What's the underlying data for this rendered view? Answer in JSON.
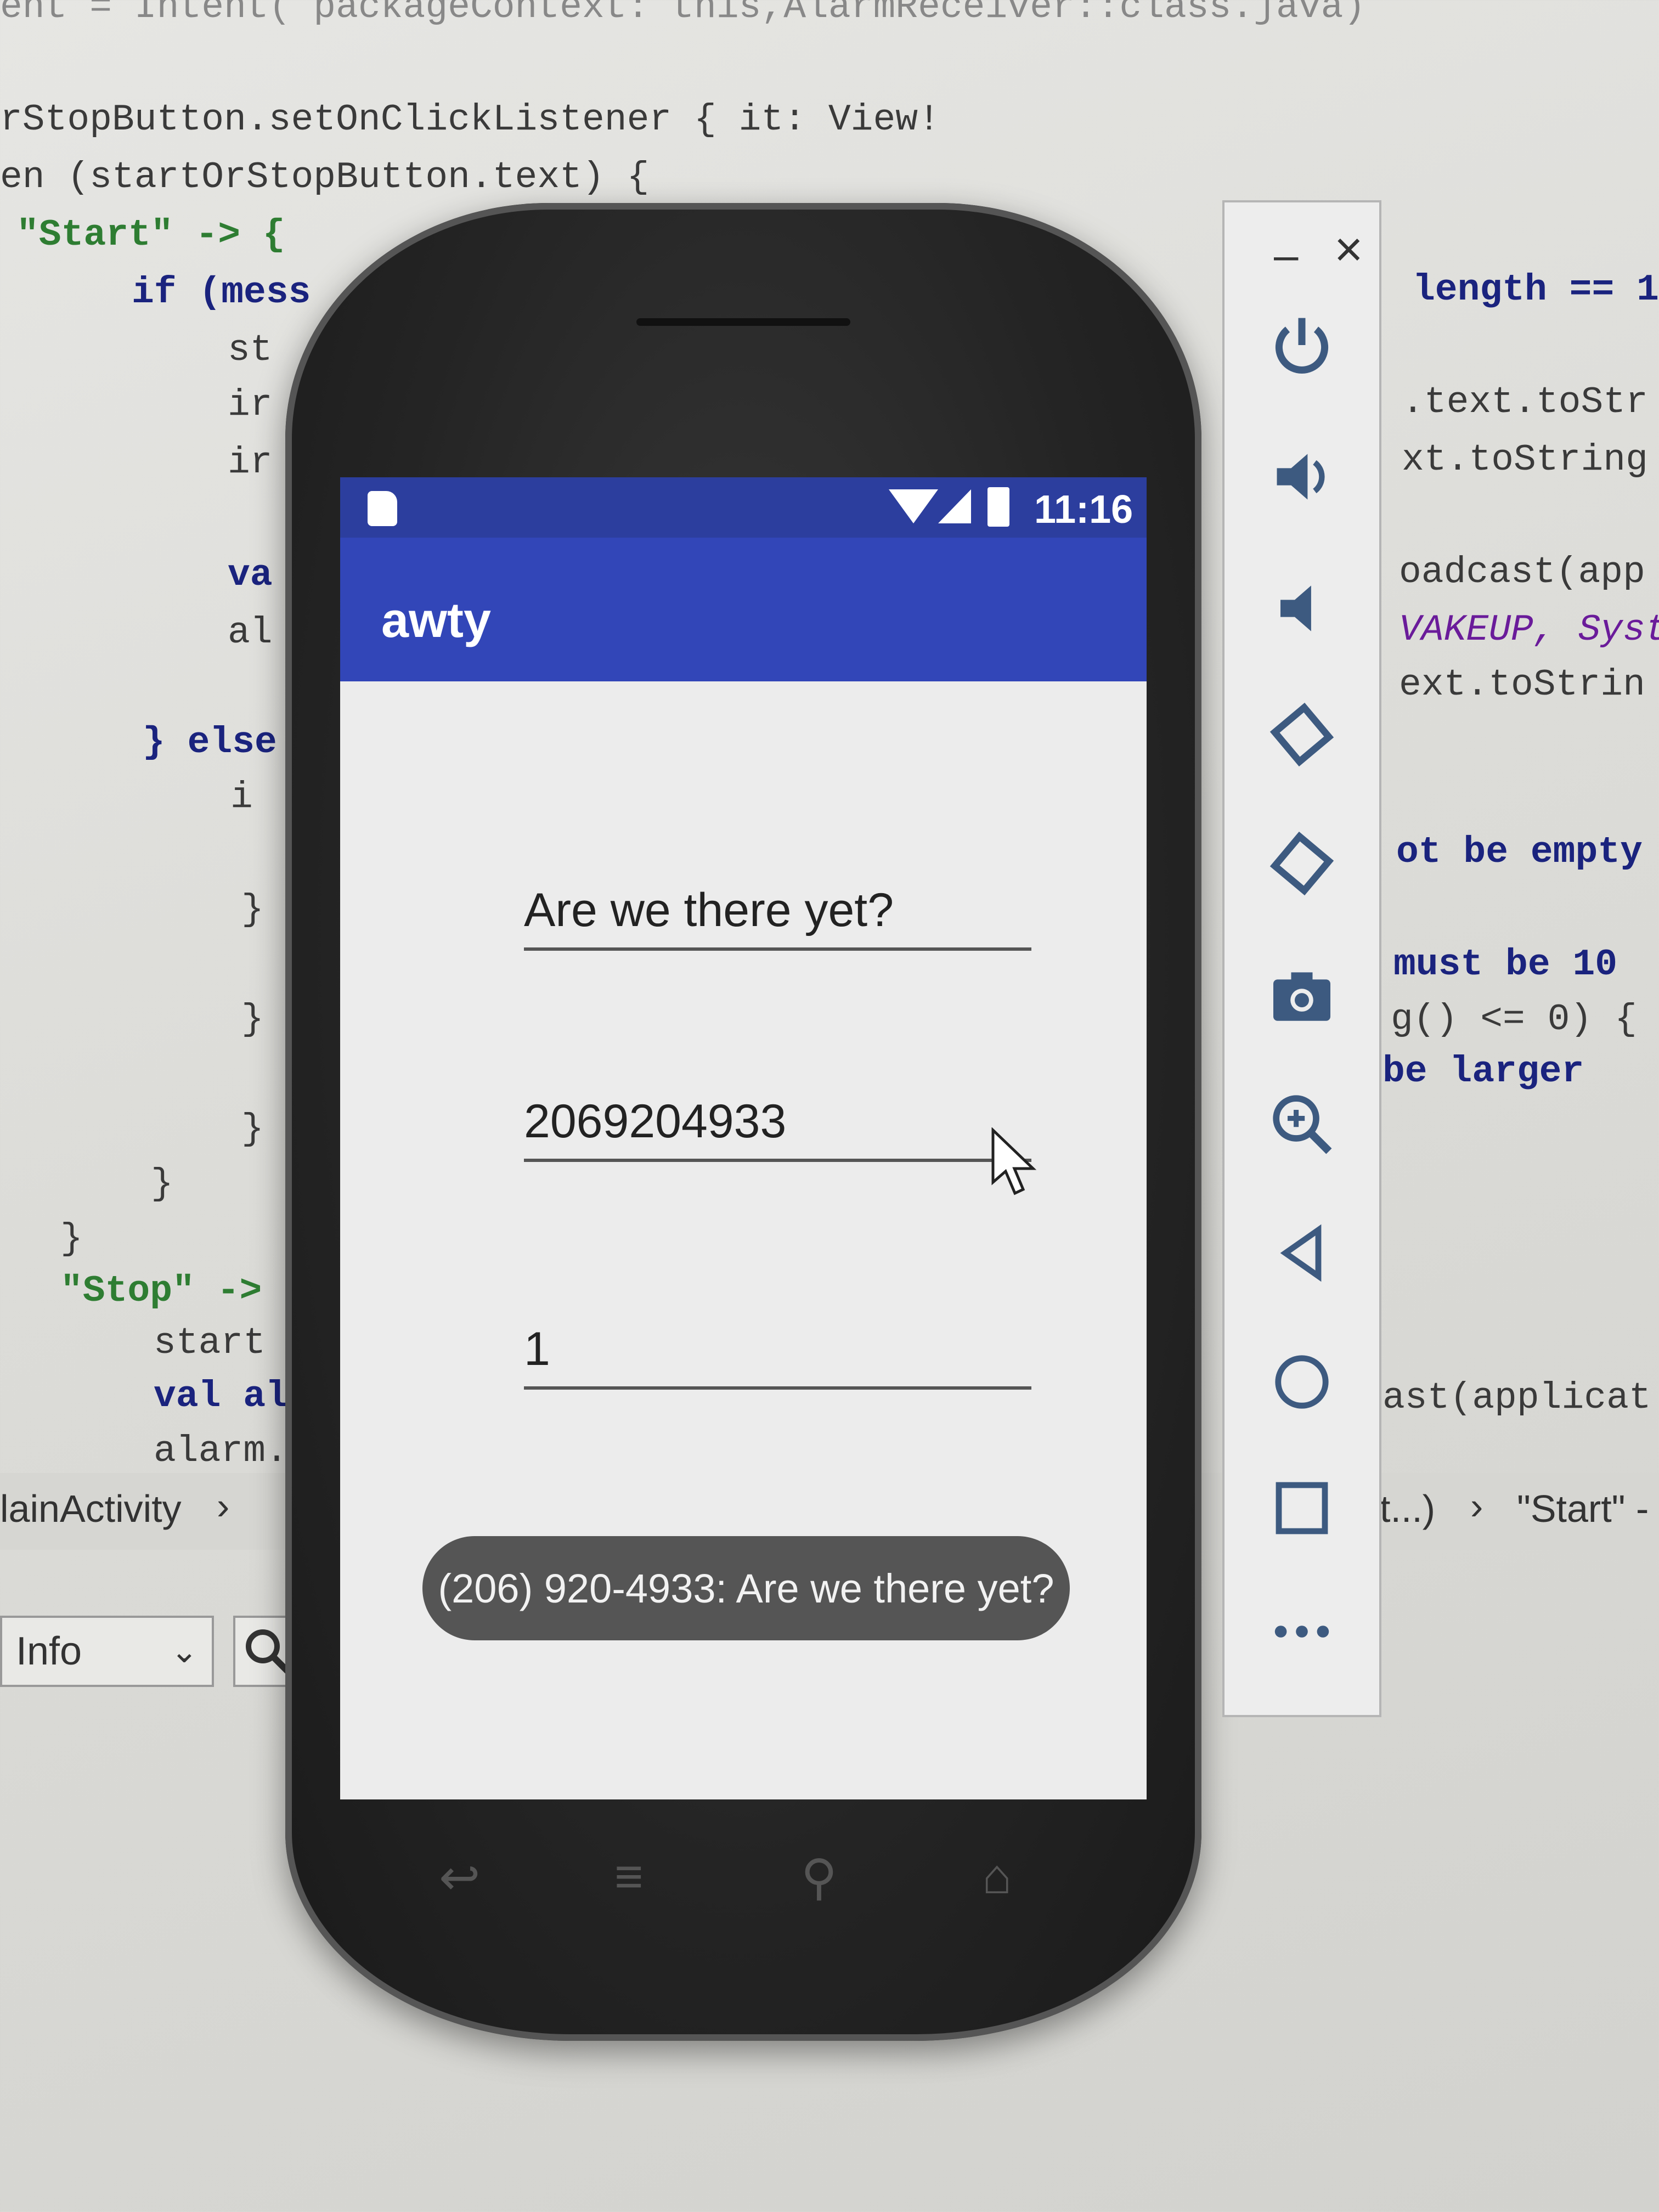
{
  "ide": {
    "code_lines": [
      "ent = Intent( packageContext: this,AlarmReceiver::class.java)",
      "rStopButton.setOnClickListener { it: View!",
      "en (startOrStopButton.text) {",
      "\"Start\" -> {",
      "if (mess",
      "st",
      "ir",
      "ir",
      "va",
      "al",
      "} else",
      "i",
      "}",
      "}",
      "}",
      "}",
      "}",
      "\"Stop\" ->",
      "start",
      "val al",
      "alarm."
    ],
    "right_code_lines": [
      "length == 1",
      ".text.toStr",
      "xt.toString",
      "oadcast(app",
      "VAKEUP, Syst",
      "ext.toStrin",
      "ot be empty",
      "must be 10",
      "g() <= 0) {",
      "be larger",
      "ast(applicat"
    ],
    "breadcrumb_left": "lainActivity",
    "breadcrumb_right": "t...)",
    "breadcrumb_start": "\"Start\" -",
    "log_level": "Info"
  },
  "phone": {
    "status_time": "11:16",
    "app_title": "awty",
    "message_field": "Are we there yet?",
    "phone_field": "2069204933",
    "interval_field": "1",
    "toast": "(206) 920-4933: Are we there yet?"
  },
  "toolbar": {
    "buttons": [
      "power-icon",
      "volume-up-icon",
      "volume-down-icon",
      "rotate-left-icon",
      "rotate-right-icon",
      "camera-icon",
      "zoom-icon",
      "back-icon",
      "home-icon",
      "overview-icon",
      "more-icon"
    ]
  }
}
